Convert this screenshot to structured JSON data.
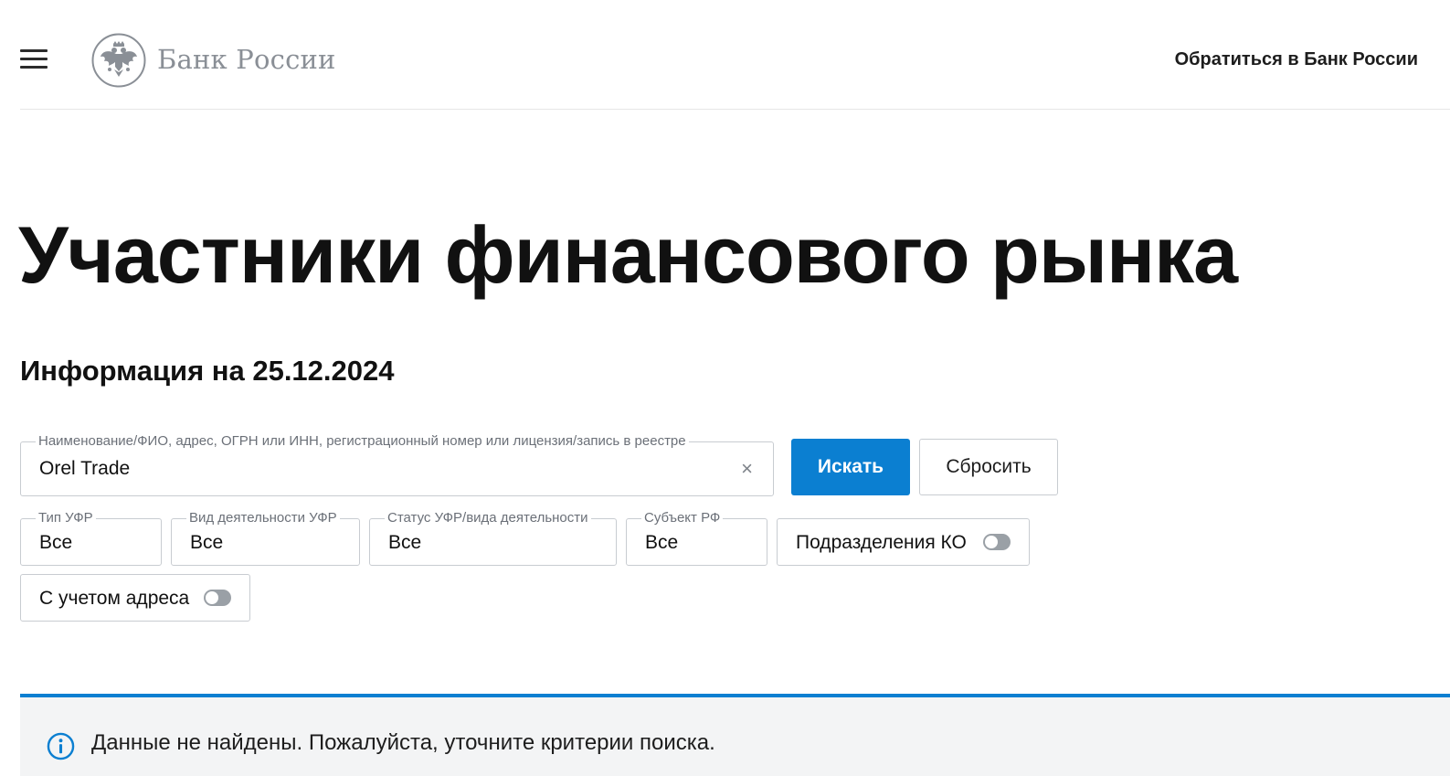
{
  "header": {
    "logo_text": "Банк России",
    "contact_label": "Обратиться в Банк России"
  },
  "page": {
    "title": "Участники финансового рынка",
    "info_date": "Информация на 25.12.2024"
  },
  "search": {
    "label": "Наименование/ФИО, адрес, ОГРН или ИНН, регистрационный номер или лицензия/запись в реестре",
    "value": "Orel Trade",
    "clear_glyph": "×",
    "search_button": "Искать",
    "reset_button": "Сбросить"
  },
  "filters": [
    {
      "label": "Тип УФР",
      "value": "Все"
    },
    {
      "label": "Вид деятельности УФР",
      "value": "Все"
    },
    {
      "label": "Статус УФР/вида деятельности",
      "value": "Все"
    },
    {
      "label": "Субъект РФ",
      "value": "Все"
    }
  ],
  "toggles": {
    "branches_label": "Подразделения КО",
    "branches_on": false,
    "address_label": "С учетом адреса",
    "address_on": false
  },
  "notice": {
    "text": "Данные не найдены. Пожалуйста, уточните критерии поиска."
  },
  "colors": {
    "accent": "#0b7fd1",
    "muted_text": "#6b7078",
    "border": "#c8ccd1",
    "notice_bg": "#f3f4f5"
  },
  "icons": {
    "menu": "hamburger-icon",
    "logo": "double-headed-eagle-emblem",
    "clear": "close-icon",
    "notice": "info-icon"
  }
}
